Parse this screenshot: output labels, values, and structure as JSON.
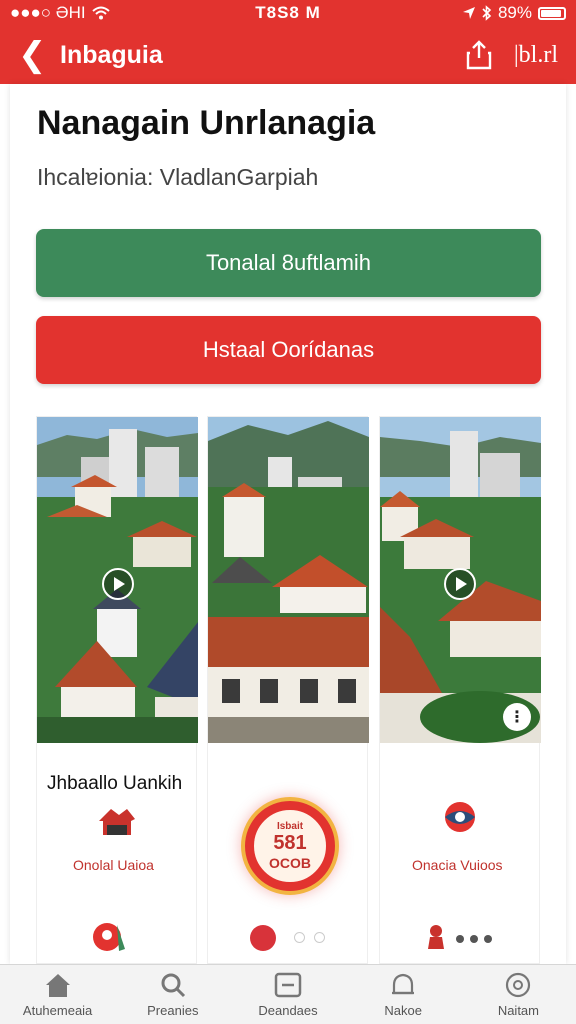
{
  "status_bar": {
    "carrier": "●●●○ ƏHI",
    "time": "T8S8 M",
    "battery": "89%",
    "battery_level": 0.89
  },
  "nav": {
    "title": "Inbaguia",
    "action_label": "|bl.rl"
  },
  "page": {
    "title": "Nanagain Unrlanagia",
    "subtitle": "Ihcalɐionia: VladlanGarpiah"
  },
  "buttons": {
    "primary": "Tonalal 8uftlamih",
    "secondary": "Hstaal Oorídanas"
  },
  "gallery": {
    "cards": [
      {
        "title": "Jhbaallo Uankih",
        "caption": "Onolal Uaioa",
        "icons": [
          "play-icon",
          "house-logo-icon",
          "map-pin-icon"
        ]
      },
      {
        "badge_line1": "Isbait",
        "badge_line2": "581",
        "badge_line3": "OCOB",
        "icons": [
          "badge-icon"
        ]
      },
      {
        "caption": "Onacia Vuioos",
        "icons": [
          "play-icon",
          "more-icon",
          "circle-logo-icon",
          "pawn-icon"
        ]
      }
    ]
  },
  "tabs": [
    {
      "label": "Atuhemeaia",
      "icon": "home-icon"
    },
    {
      "label": "Preanies",
      "icon": "search-icon"
    },
    {
      "label": "Deandaes",
      "icon": "minus-square-icon"
    },
    {
      "label": "Nakoe",
      "icon": "bell-icon"
    },
    {
      "label": "Naitam",
      "icon": "circle-icon"
    }
  ],
  "colors": {
    "brand_red": "#e2332f",
    "accent_green": "#3d8a5a",
    "badge_gold": "#f2b441"
  }
}
